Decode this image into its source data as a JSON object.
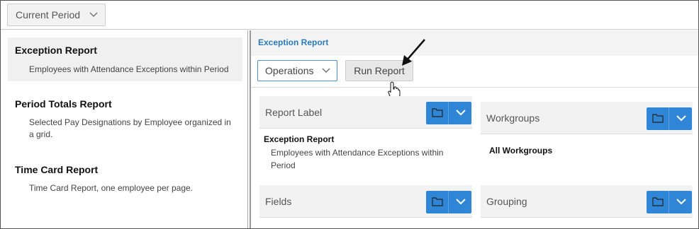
{
  "topbar": {
    "period_select": {
      "value": "Current Period",
      "icon": "chevron-down-icon"
    }
  },
  "reports": [
    {
      "title": "Exception Report",
      "description": "Employees with Attendance Exceptions within Period",
      "selected": true
    },
    {
      "title": "Period Totals Report",
      "description": "Selected Pay Designations by Employee organized in a grid.",
      "selected": false
    },
    {
      "title": "Time Card Report",
      "description": "Time Card Report, one employee per page.",
      "selected": false
    }
  ],
  "detail": {
    "header_title": "Exception Report",
    "operations_select": {
      "value": "Operations"
    },
    "run_button_label": "Run Report",
    "cards": {
      "report_label": {
        "label": "Report Label",
        "title": "Exception Report",
        "description": "Employees with Attendance Exceptions within Period"
      },
      "workgroups": {
        "label": "Workgroups",
        "value": "All Workgroups"
      },
      "fields": {
        "label": "Fields"
      },
      "grouping": {
        "label": "Grouping"
      }
    }
  },
  "colors": {
    "accent": "#2f86d6",
    "link": "#2a7bc0",
    "selected_bg": "#f0f0f0"
  }
}
